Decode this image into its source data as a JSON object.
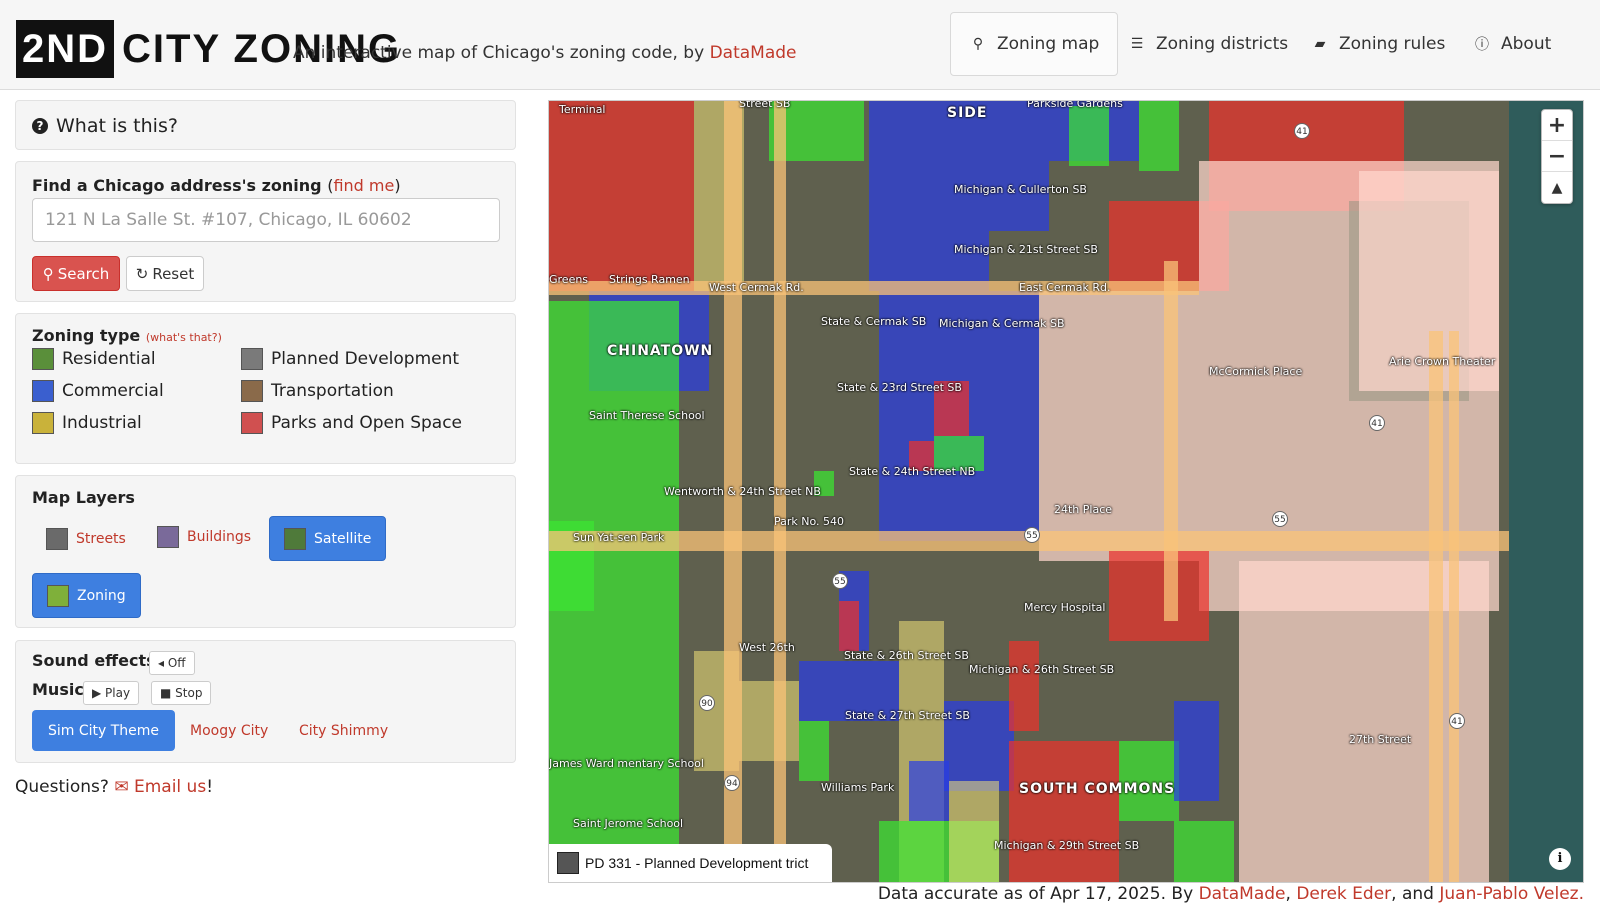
{
  "header": {
    "logo": {
      "box_text": "2ND",
      "rest_text": "CITY ZONING"
    },
    "tagline": {
      "prefix": "An interactive map of Chicago's zoning code, by ",
      "link": "DataMade"
    },
    "nav": [
      {
        "label": "Zoning map",
        "icon": "map-marker-icon",
        "glyph": "⚲"
      },
      {
        "label": "Zoning districts",
        "icon": "list-icon",
        "glyph": "☰"
      },
      {
        "label": "Zoning rules",
        "icon": "book-icon",
        "glyph": "▰"
      },
      {
        "label": "About",
        "icon": "info-icon",
        "glyph": "ⓘ"
      }
    ]
  },
  "what": {
    "title": "What is this?",
    "glyph": "?"
  },
  "find": {
    "label": "Find a Chicago address's zoning",
    "find_me": "find me",
    "placeholder": "121 N La Salle St. #107, Chicago, IL 60602",
    "search_label": "Search",
    "search_glyph": "⚲",
    "reset_label": "Reset",
    "reset_glyph": "↻"
  },
  "zoning_type": {
    "label": "Zoning type",
    "whats_that": "(what's that?)",
    "items": [
      {
        "label": "Residential",
        "icon": "residential-icon",
        "color": "#5a8f3a"
      },
      {
        "label": "Commercial",
        "icon": "commercial-icon",
        "color": "#3a5fcf"
      },
      {
        "label": "Industrial",
        "icon": "industrial-icon",
        "color": "#c9b23a"
      },
      {
        "label": "Planned Development",
        "icon": "planned-development-icon",
        "color": "#7a7a7a"
      },
      {
        "label": "Transportation",
        "icon": "transportation-icon",
        "color": "#8a6a4a"
      },
      {
        "label": "Parks and Open Space",
        "icon": "parks-icon",
        "color": "#d05050"
      }
    ]
  },
  "layers": {
    "label": "Map Layers",
    "items": [
      {
        "label": "Streets",
        "icon": "streets-icon",
        "active": false
      },
      {
        "label": "Buildings",
        "icon": "buildings-icon",
        "active": false
      },
      {
        "label": "Satellite",
        "icon": "satellite-icon",
        "active": true
      },
      {
        "label": "Zoning",
        "icon": "zoning-icon",
        "active": true
      }
    ]
  },
  "sound": {
    "effects_label": "Sound effects",
    "effects_toggle": "◂ Off",
    "music_label": "Music",
    "play_label": "▶ Play",
    "stop_label": "■ Stop",
    "tracks": [
      {
        "label": "Sim City Theme",
        "active": true
      },
      {
        "label": "Moogy City",
        "active": false
      },
      {
        "label": "City Shimmy",
        "active": false
      }
    ]
  },
  "questions": {
    "prefix": "Questions? ",
    "link": "Email us",
    "suffix": "!",
    "glyph": "✉"
  },
  "map": {
    "labels": {
      "chinatown": "CHINATOWN",
      "south_commons": "SOUTH COMMONS",
      "side": "SIDE",
      "west_cermak": "West Cermak Rd.",
      "east_cermak": "East Cermak Rd.",
      "mccormick": "McCormick Place",
      "arie_crown": "Arie Crown Theater",
      "state_cermak": "State & Cermak SB",
      "state_23rd": "State & 23rd Street SB",
      "state_24th": "State & 24th Street NB",
      "wentworth": "Wentworth & 24th Street NB",
      "park540": "Park No. 540",
      "sun_yat_sen": "Sun Yat-sen Park",
      "mercy": "Mercy Hospital",
      "williams_park": "Williams Park",
      "st_jerome": "Saint Jerome School",
      "st_therese": "Saint Therese School",
      "james_ward": "James Ward mentary School",
      "27th": "27th Street",
      "24th_place": "24th Place",
      "michigan_cullerton": "Michigan & Cullerton SB",
      "michigan_21st": "Michigan & 21st Street SB",
      "michigan_cermak": "Michigan & Cermak SB",
      "state_26th": "State & 26th Street SB",
      "state_27th": "State & 27th Street SB",
      "michigan_26th": "Michigan & 26th Street SB",
      "michigan_29th": "Michigan & 29th Street SB",
      "strings_ramen": "Strings Ramen",
      "terminal": "Terminal",
      "greens": "Greens",
      "parkside": "Parkside Gardens",
      "street_sb": "Street SB",
      "w26th": "West 26th",
      "hwy55a": "55",
      "hwy55b": "55",
      "hwy55c": "55",
      "hwy41a": "41",
      "hwy41b": "41",
      "hwy41c": "41",
      "hwy90": "90",
      "hwy94": "94"
    },
    "zoom_in": "+",
    "zoom_out": "−",
    "reset_north": "▲",
    "info": "i",
    "tooltip": "PD 331 - Planned Development   trict"
  },
  "footer": {
    "prefix": "Data accurate as of Apr 17, 2025. By ",
    "author1": "DataMade",
    "sep1": ", ",
    "author2": "Derek Eder",
    "sep2": ", and ",
    "author3": "Juan-Pablo Velez."
  }
}
